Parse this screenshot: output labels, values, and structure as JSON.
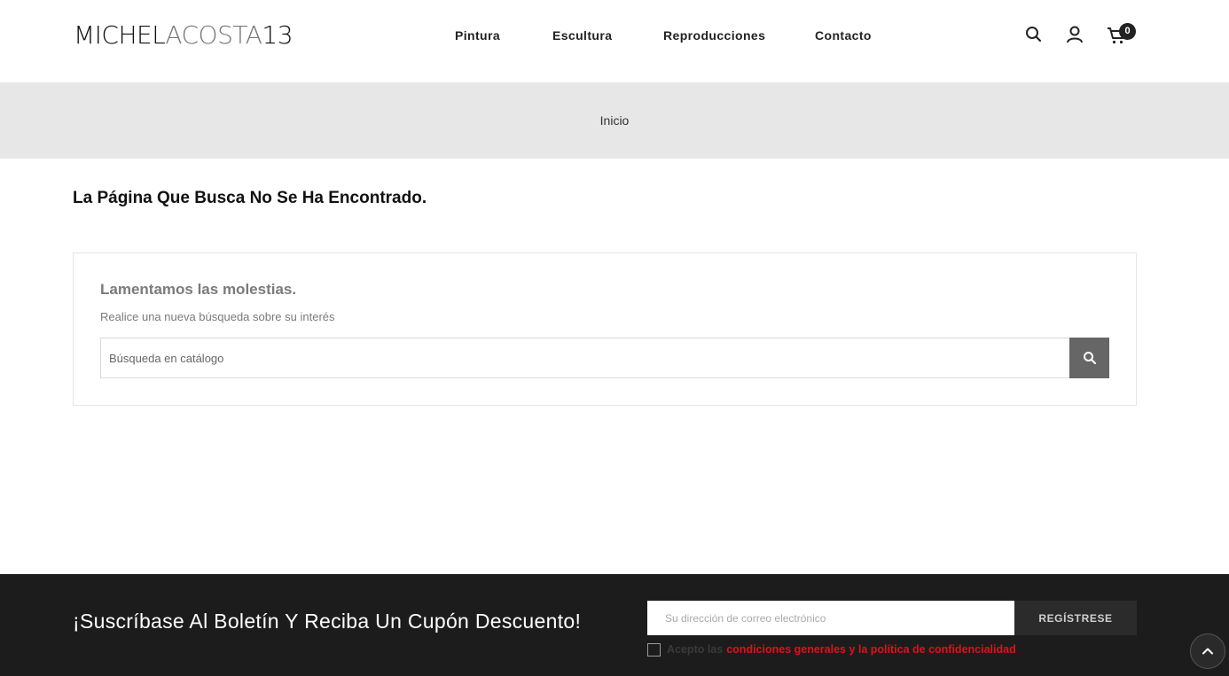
{
  "header": {
    "logo": {
      "part1": "MICHEL",
      "part2": "ACOSTA",
      "part3": "13"
    },
    "nav": [
      {
        "label": "Pintura"
      },
      {
        "label": "Escultura"
      },
      {
        "label": "Reproducciones"
      },
      {
        "label": "Contacto"
      }
    ],
    "icons": {
      "search": "search-icon",
      "account": "user-icon",
      "cart": "cart-icon"
    },
    "cart_count": "0"
  },
  "breadcrumb": {
    "label": "Inicio"
  },
  "main": {
    "title": "La Página Que Busca No Se Ha Encontrado.",
    "box_title": "Lamentamos las molestias.",
    "box_subtitle": "Realice una nueva búsqueda sobre su interés",
    "search_placeholder": "Búsqueda en catálogo"
  },
  "footer": {
    "newsletter_title": "¡Suscríbase Al Boletín Y Reciba Un Cupón Descuento!",
    "email_placeholder": "Su dirección de correo electrónico",
    "subscribe_label": "REGÍSTRESE",
    "consent_text": "Acepto las",
    "consent_link": "condiciones generales y la política de confidencialidad"
  },
  "colors": {
    "accent_link": "#e0111b",
    "footer_bg": "#1c1c1c",
    "breadcrumb_bg": "#e7e7e7",
    "search_button": "#666666"
  }
}
